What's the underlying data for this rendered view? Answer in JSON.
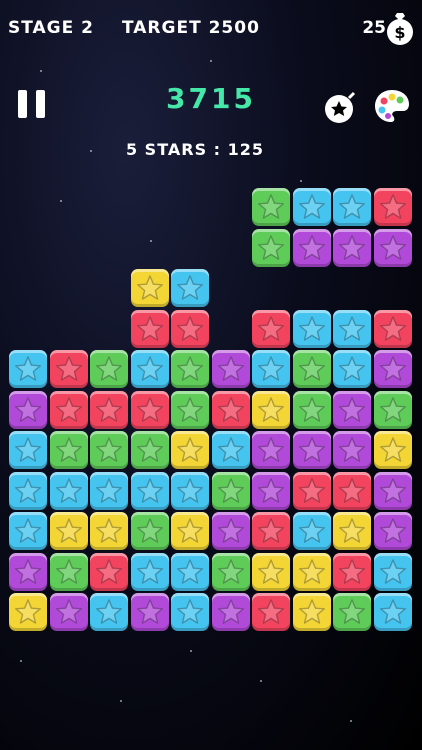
{
  "header": {
    "stage": "STAGE 2",
    "target": "TARGET 2500",
    "coins": "25",
    "score": "3715",
    "bonus": "5 STARS : 125"
  },
  "icons": {
    "pause": "pause-icon",
    "bomb": "bomb-icon",
    "palette": "palette-icon",
    "money_bag": "money-bag-icon",
    "block": "star-icon"
  },
  "colors": {
    "B": "#45c4f0",
    "R": "#f2445f",
    "G": "#5fcc5a",
    "P": "#b14ad8",
    "Y": "#f3d535",
    "score": "#45e8a8"
  },
  "board": {
    "columns": 10,
    "rows": 10,
    "grid": [
      "......GBBR",
      "......GPPP",
      "...YB.....",
      "...RR.RBBR",
      "BRGBGPBGBP",
      "PRRRGRYGPG",
      "BGGGYBPPPY",
      "BBBBBGPRRP",
      "BYYGYPRBYP",
      "PGRBBGYYRB",
      "YPBPBPRYGB"
    ]
  }
}
